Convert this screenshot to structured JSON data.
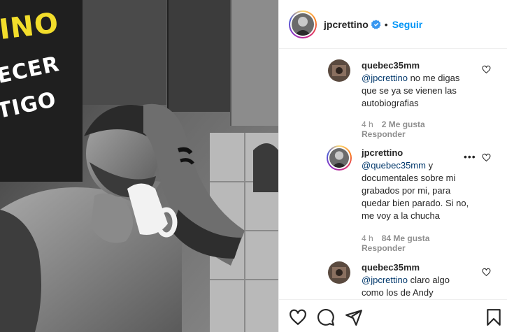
{
  "promo": {
    "line1": "INO",
    "line2": "ECER",
    "line3": "TIGO",
    "accent_color": "#f2dd2b"
  },
  "post_header": {
    "username": "jpcrettino",
    "verified_icon": "verified-badge-icon",
    "separator": "•",
    "follow_label": "Seguir"
  },
  "comments": [
    {
      "username": "quebec35mm",
      "mention": "@jpcrettino",
      "text": " no me digas que se ya se vienen las autobiografias",
      "time": "4 h",
      "likes": "2 Me gusta",
      "reply_label": "Responder"
    },
    {
      "username": "jpcrettino",
      "mention": "@quebec35mm",
      "text": " y documentales sobre mi grabados por mi, para quedar bien parado. Si no, me voy a la chucha",
      "time": "4 h",
      "likes": "84 Me gusta",
      "reply_label": "Responder",
      "more": "•••"
    },
    {
      "username": "quebec35mm",
      "mention": "@jpcrettino",
      "text": " claro algo como los de Andy"
    }
  ],
  "icons": {
    "like": "heart-icon",
    "comment": "comment-icon",
    "share": "share-icon",
    "save": "bookmark-icon"
  },
  "colors": {
    "link_blue": "#0095f6",
    "mention_blue": "#00376b",
    "muted_gray": "#8e8e8e"
  }
}
